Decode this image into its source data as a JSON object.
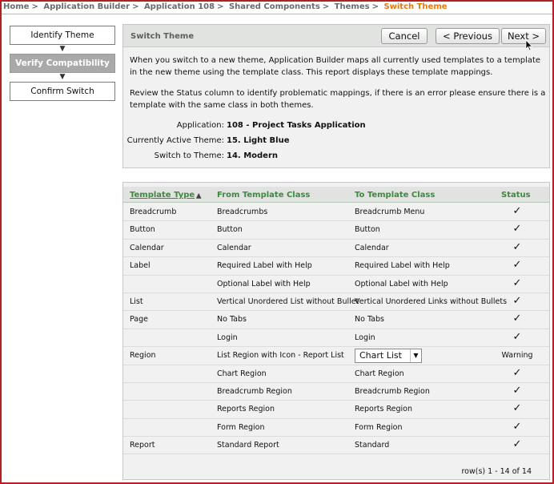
{
  "breadcrumb": {
    "items": [
      "Home",
      "Application Builder",
      "Application 108",
      "Shared Components",
      "Themes"
    ],
    "current": "Switch Theme",
    "separator": ">"
  },
  "wizard": {
    "steps": [
      "Identify Theme",
      "Verify Compatibility",
      "Confirm Switch"
    ],
    "active_index": 1
  },
  "panel": {
    "title": "Switch Theme",
    "cancel_label": "Cancel",
    "previous_label": "< Previous",
    "next_label": "Next >",
    "description1": "When you switch to a new theme, Application Builder maps all currently used templates to a template in the new theme using the template class. This report displays these template mappings.",
    "description2": "Review the Status column to identify problematic mappings, if there is an error please ensure there is a template with the same class in both themes.",
    "info": [
      {
        "label": "Application:",
        "value": "108 - Project Tasks Application"
      },
      {
        "label": "Currently Active Theme:",
        "value": "15. Light Blue"
      },
      {
        "label": "Switch to Theme:",
        "value": "14. Modern"
      }
    ]
  },
  "table": {
    "headers": [
      "Template Type",
      "From Template Class",
      "To Template Class",
      "Status"
    ],
    "sort_indicator": "▲",
    "rows": [
      {
        "type": "Breadcrumb",
        "from": "Breadcrumbs",
        "to": "Breadcrumb Menu",
        "status": "✓"
      },
      {
        "type": "Button",
        "from": "Button",
        "to": "Button",
        "status": "✓"
      },
      {
        "type": "Calendar",
        "from": "Calendar",
        "to": "Calendar",
        "status": "✓"
      },
      {
        "type": "Label",
        "from": "Required Label with Help",
        "to": "Required Label with Help",
        "status": "✓"
      },
      {
        "type": "",
        "from": "Optional Label with Help",
        "to": "Optional Label with Help",
        "status": "✓"
      },
      {
        "type": "List",
        "from": "Vertical Unordered List without Bullet",
        "to": "Vertical Unordered Links without Bullets",
        "status": "✓"
      },
      {
        "type": "Page",
        "from": "No Tabs",
        "to": "No Tabs",
        "status": "✓"
      },
      {
        "type": "",
        "from": "Login",
        "to": "Login",
        "status": "✓"
      },
      {
        "type": "Region",
        "from": "List Region with Icon - Report List",
        "to": "Chart List",
        "status": "Warning",
        "select": true
      },
      {
        "type": "",
        "from": "Chart Region",
        "to": "Chart Region",
        "status": "✓"
      },
      {
        "type": "",
        "from": "Breadcrumb Region",
        "to": "Breadcrumb Region",
        "status": "✓"
      },
      {
        "type": "",
        "from": "Reports Region",
        "to": "Reports Region",
        "status": "✓"
      },
      {
        "type": "",
        "from": "Form Region",
        "to": "Form Region",
        "status": "✓"
      },
      {
        "type": "Report",
        "from": "Standard Report",
        "to": "Standard",
        "status": "✓"
      }
    ],
    "footer": "row(s) 1 - 14 of 14"
  },
  "colors": {
    "accent_current": "#e07a12",
    "header_text": "#3c8a3c",
    "frame_border": "#b42020"
  },
  "icons": {
    "dropdown": "chevron-down-icon",
    "status_ok": "checkmark-icon",
    "cursor": "mouse-pointer-icon",
    "step_arrow": "arrow-down-icon"
  }
}
